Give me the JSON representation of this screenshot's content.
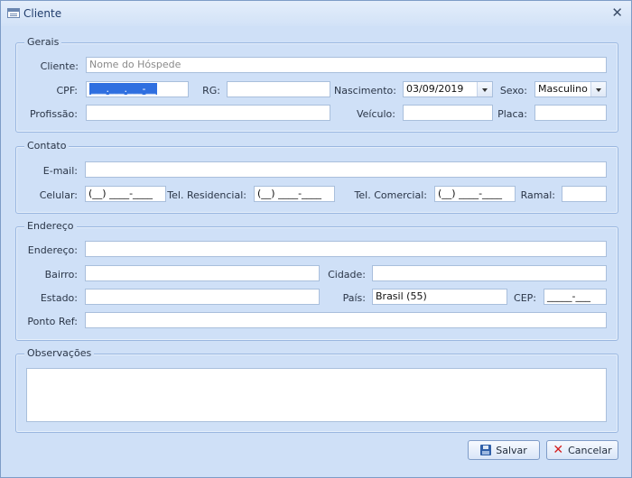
{
  "window": {
    "title": "Cliente"
  },
  "gerais": {
    "legend": "Gerais",
    "cliente_label": "Cliente:",
    "cliente_placeholder": "Nome do Hóspede",
    "cpf_label": "CPF:",
    "cpf_value": "___.___.___-__",
    "rg_label": "RG:",
    "rg_value": "",
    "nascimento_label": "Nascimento:",
    "nascimento_value": "03/09/2019",
    "sexo_label": "Sexo:",
    "sexo_value": "Masculino",
    "profissao_label": "Profissão:",
    "profissao_value": "",
    "veiculo_label": "Veículo:",
    "veiculo_value": "",
    "placa_label": "Placa:",
    "placa_value": ""
  },
  "contato": {
    "legend": "Contato",
    "email_label": "E-mail:",
    "email_value": "",
    "celular_label": "Celular:",
    "celular_value": "(__) ____-____",
    "tel_res_label": "Tel. Residencial:",
    "tel_res_value": "(__) ____-____",
    "tel_com_label": "Tel. Comercial:",
    "tel_com_value": "(__) ____-____",
    "ramal_label": "Ramal:",
    "ramal_value": ""
  },
  "endereco": {
    "legend": "Endereço",
    "endereco_label": "Endereço:",
    "endereco_value": "",
    "bairro_label": "Bairro:",
    "bairro_value": "",
    "cidade_label": "Cidade:",
    "cidade_value": "",
    "estado_label": "Estado:",
    "estado_value": "",
    "pais_label": "País:",
    "pais_value": "Brasil (55)",
    "cep_label": "CEP:",
    "cep_value": "_____-___",
    "ponto_ref_label": "Ponto Ref:",
    "ponto_ref_value": ""
  },
  "observacoes": {
    "legend": "Observações",
    "value": ""
  },
  "buttons": {
    "salvar": "Salvar",
    "cancelar": "Cancelar"
  }
}
